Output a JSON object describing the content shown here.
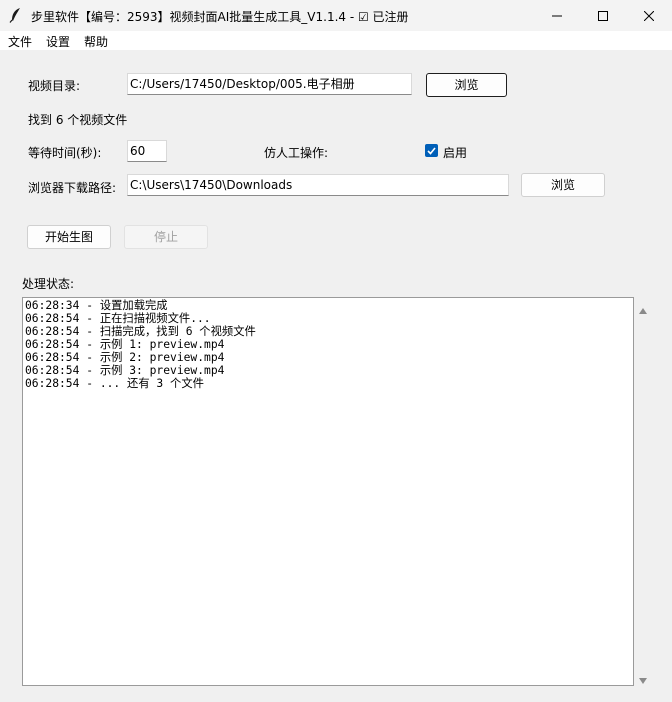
{
  "window": {
    "title": "步里软件【编号：2593】视频封面AI批量生成工具_V1.1.4 - ☑ 已注册",
    "app_icon": "feather-icon",
    "controls": [
      "minimize-icon",
      "maximize-icon",
      "close-icon"
    ]
  },
  "menu": {
    "items": [
      "文件",
      "设置",
      "帮助"
    ]
  },
  "form": {
    "video_dir_label": "视频目录:",
    "video_dir_value": "C:/Users/17450/Desktop/005.电子相册",
    "browse_label": "浏览",
    "found_text": "找到 6 个视频文件",
    "wait_label": "等待时间(秒):",
    "wait_value": "60",
    "human_label": "仿人工操作:",
    "enable_label": "启用",
    "enable_checked": true,
    "download_label": "浏览器下载路径:",
    "download_value": "C:\\Users\\17450\\Downloads",
    "browse2_label": "浏览",
    "start_label": "开始生图",
    "stop_label": "停止"
  },
  "status": {
    "label": "处理状态:",
    "lines": [
      "06:28:34 - 设置加载完成",
      "06:28:54 - 正在扫描视频文件...",
      "06:28:54 - 扫描完成，找到 6 个视频文件",
      "06:28:54 - 示例 1: preview.mp4",
      "06:28:54 - 示例 2: preview.mp4",
      "06:28:54 - 示例 3: preview.mp4",
      "06:28:54 - ... 还有 3 个文件"
    ]
  },
  "colors": {
    "accent": "#005fb8",
    "window_bg": "#f0f0f0"
  }
}
